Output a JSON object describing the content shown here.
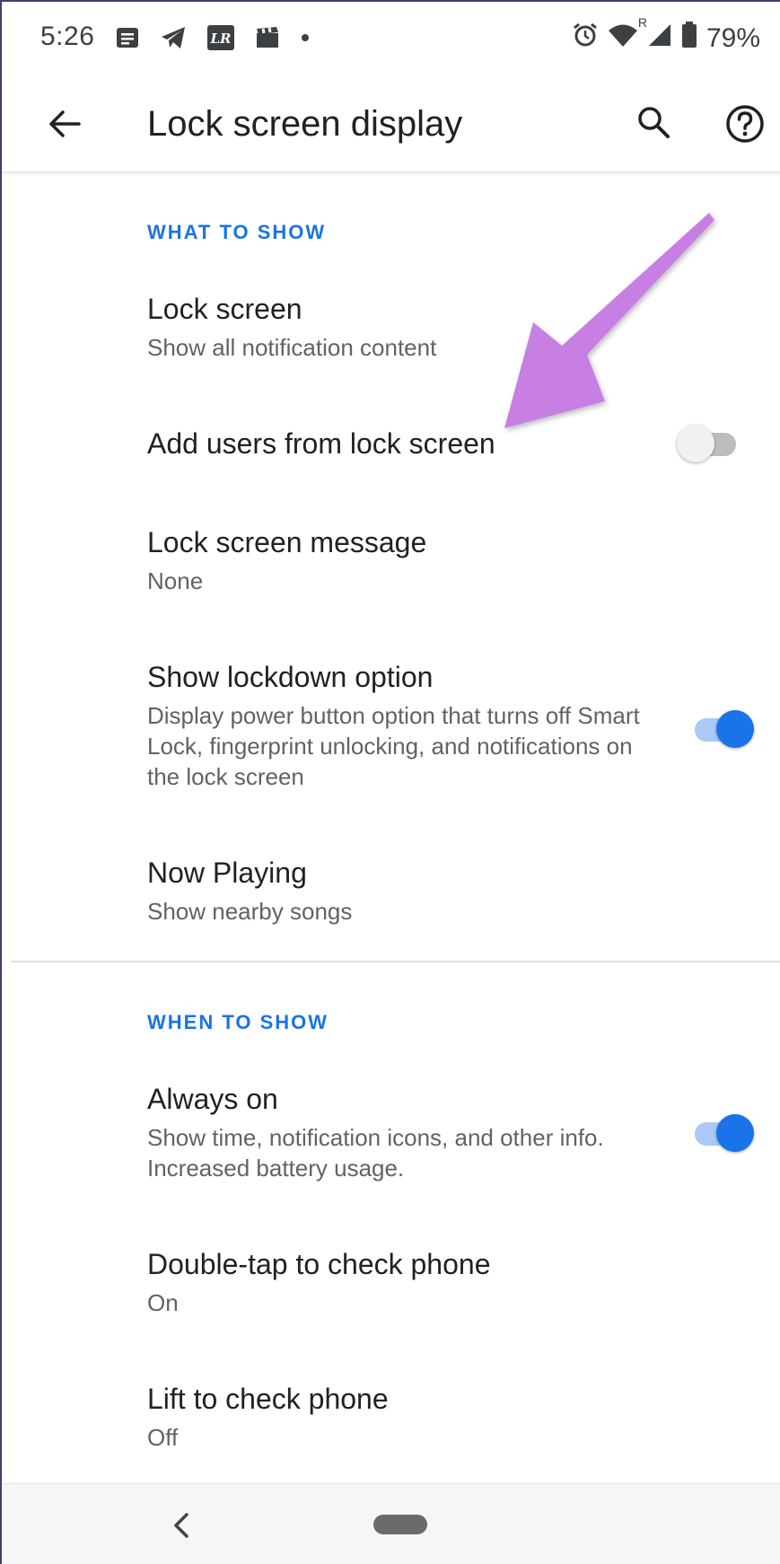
{
  "status_bar": {
    "time": "5:26",
    "battery": "79%",
    "icons": [
      "notes-icon",
      "telegram-icon",
      "lightroom-icon",
      "clapper-icon",
      "dot-icon",
      "alarm-icon",
      "wifi-icon",
      "signal-icon",
      "battery-icon"
    ],
    "roaming_label": "R"
  },
  "app_bar": {
    "title": "Lock screen display",
    "back_icon": "arrow-left-icon",
    "search_icon": "search-icon",
    "help_icon": "help-circle-icon"
  },
  "sections": {
    "what_to_show": "WHAT TO SHOW",
    "when_to_show": "WHEN TO SHOW"
  },
  "items": {
    "lock_screen": {
      "title": "Lock screen",
      "subtitle": "Show all notification content"
    },
    "add_users": {
      "title": "Add users from lock screen",
      "enabled": false
    },
    "lock_message": {
      "title": "Lock screen message",
      "subtitle": "None"
    },
    "lockdown": {
      "title": "Show lockdown option",
      "subtitle": "Display power button option that turns off Smart Lock, fingerprint unlocking, and notifications on the lock screen",
      "enabled": true
    },
    "now_playing": {
      "title": "Now Playing",
      "subtitle": "Show nearby songs"
    },
    "always_on": {
      "title": "Always on",
      "subtitle": "Show time, notification icons, and other info. Increased battery usage.",
      "enabled": true
    },
    "double_tap": {
      "title": "Double-tap to check phone",
      "subtitle": "On"
    },
    "lift": {
      "title": "Lift to check phone",
      "subtitle": "Off"
    }
  },
  "nav_bar": {
    "back_icon": "nav-back-icon",
    "home_icon": "home-pill-icon"
  },
  "colors": {
    "accent": "#1a73e8",
    "arrow": "#c77fe3"
  }
}
